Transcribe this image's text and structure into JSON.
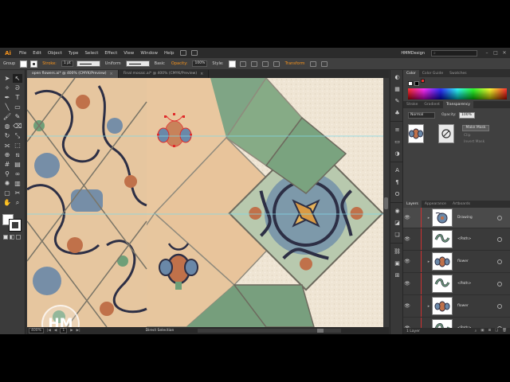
{
  "app": {
    "logo": "Ai",
    "workspace": "HMMDesign",
    "search_placeholder": ""
  },
  "menu": [
    "File",
    "Edit",
    "Object",
    "Type",
    "Select",
    "Effect",
    "View",
    "Window",
    "Help"
  ],
  "control_bar": {
    "selection": "Group",
    "stroke_label": "Stroke:",
    "stroke_value": "1 pt",
    "profile": "Uniform",
    "brush": "Basic",
    "opacity_label": "Opacity:",
    "opacity_value": "100%",
    "style_label": "Style:",
    "transform_label": "Transform"
  },
  "doc_tabs": [
    {
      "label": "open flowers.ai* @ 400% (CMYK/Preview)",
      "active": true
    },
    {
      "label": "Final mosaic.ai* @ 400% (CMYK/Preview)",
      "active": false
    }
  ],
  "status_bar": {
    "zoom": "400%",
    "page": "1",
    "tool": "Direct Selection"
  },
  "panels": {
    "color_tabs": [
      "Color",
      "Color Guide",
      "Swatches"
    ],
    "stroke_tabs": [
      "Stroke",
      "Gradient",
      "Transparency"
    ],
    "blend_mode": "Normal",
    "opacity_label": "Opacity:",
    "opacity_value": "100%",
    "make_mask": "Make Mask",
    "clip": "Clip",
    "invert_mask": "Invert Mask"
  },
  "layers": {
    "tabs": [
      "Layers",
      "Appearance",
      "Artboards"
    ],
    "items": [
      {
        "name": "Drawing",
        "kind": "layer",
        "selected": false
      },
      {
        "name": "<Path>",
        "kind": "path",
        "selected": false
      },
      {
        "name": "flower",
        "kind": "flower",
        "selected": false
      },
      {
        "name": "<Path>",
        "kind": "path",
        "selected": false
      },
      {
        "name": "flower",
        "kind": "flower",
        "selected": false
      },
      {
        "name": "<Path>",
        "kind": "path",
        "selected": false
      },
      {
        "name": "flower",
        "kind": "flower",
        "selected": true
      }
    ],
    "footer": "1 Layer"
  },
  "watermark": "HM",
  "colors": {
    "accent": "#f7941d",
    "tile_cream": "#e9c79f",
    "tile_green": "#6f9f78",
    "tile_blue": "#6a88a8",
    "tile_rust": "#c0714a",
    "selection_red": "#e02a2a",
    "guide_cyan": "#7fd8e8"
  }
}
